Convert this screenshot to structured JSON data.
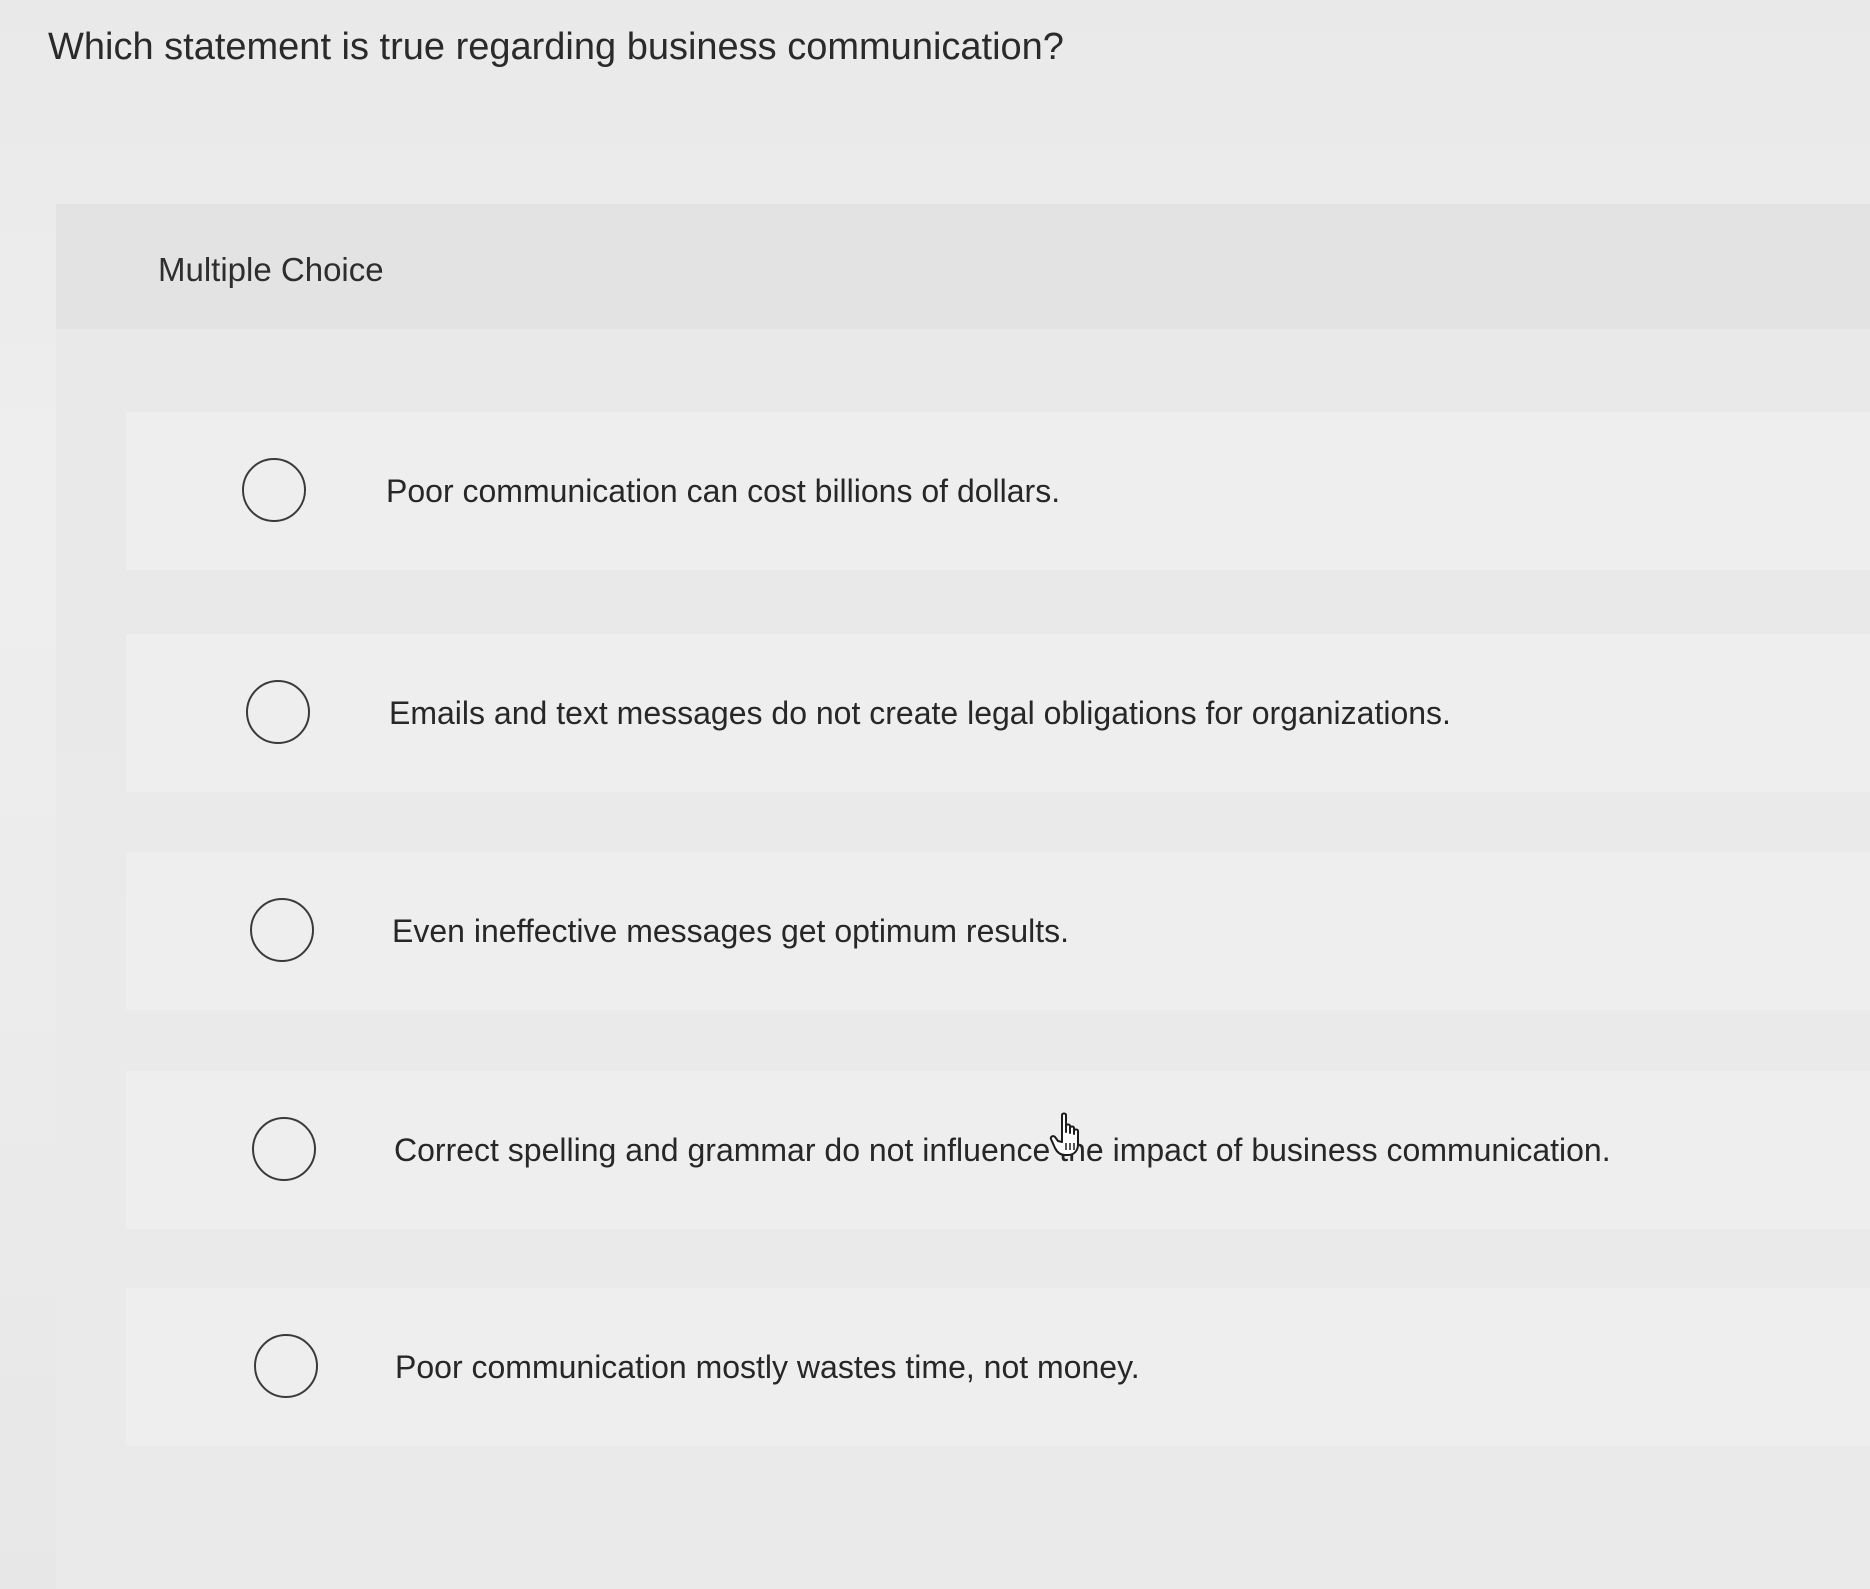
{
  "question": {
    "text": "Which statement is true regarding business communication?"
  },
  "panel": {
    "type_label": "Multiple Choice"
  },
  "options": [
    {
      "label": "Poor communication can cost billions of dollars.",
      "selected": false
    },
    {
      "label": "Emails and text messages do not create legal obligations for organizations.",
      "selected": false
    },
    {
      "label": "Even ineffective messages get optimum results.",
      "selected": false
    },
    {
      "label": "Correct spelling and grammar do not influence the impact of business communication.",
      "selected": false
    },
    {
      "label": "Poor communication mostly wastes time, not money.",
      "selected": false
    }
  ],
  "cursor": {
    "icon": "hand-pointer-icon"
  }
}
